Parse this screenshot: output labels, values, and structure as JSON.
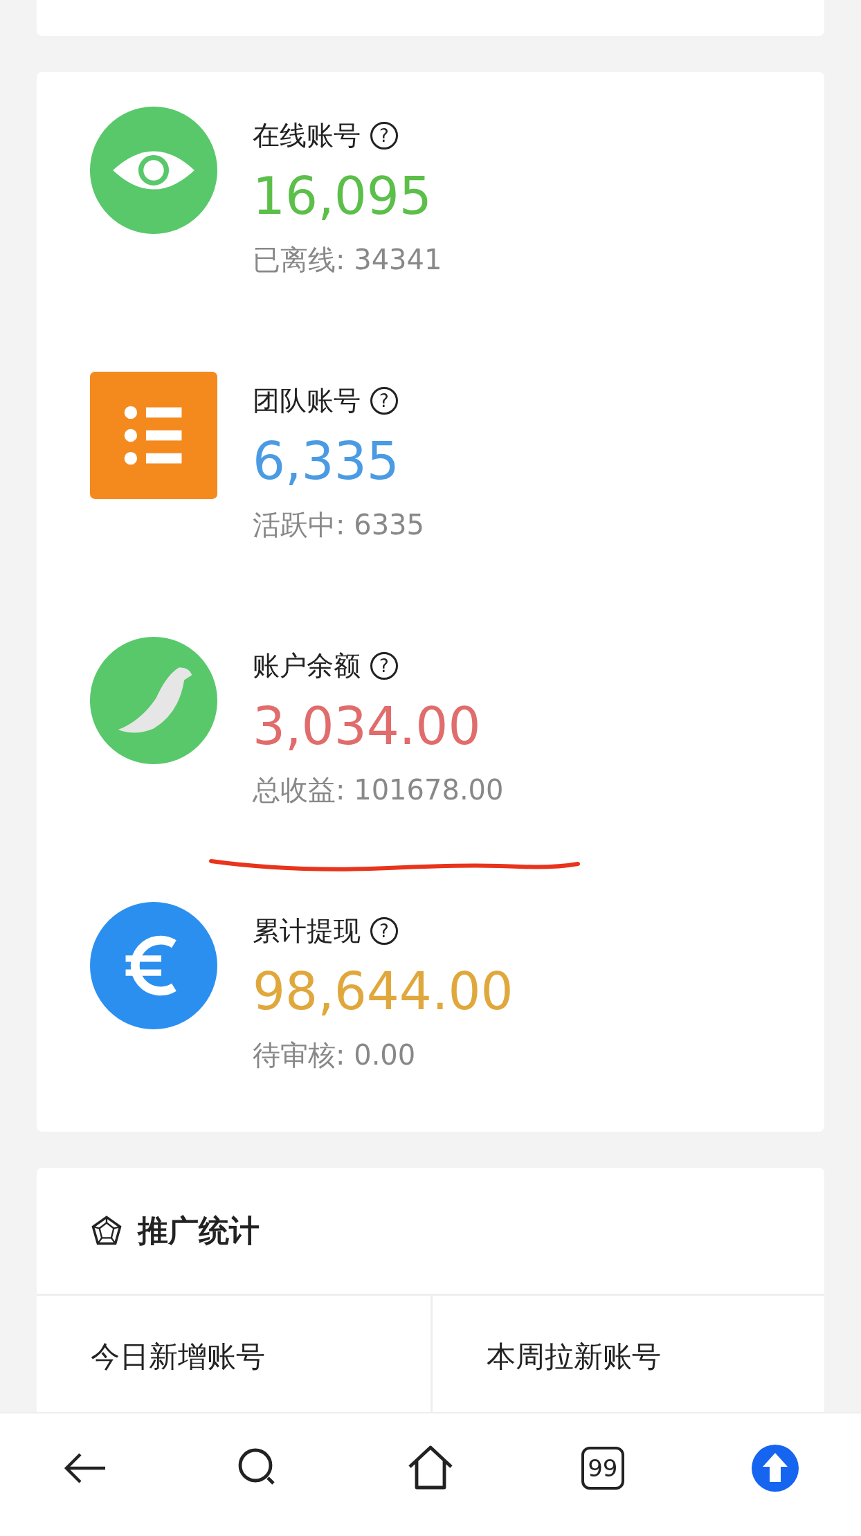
{
  "stats": [
    {
      "kind": "eye",
      "title": "在线账号",
      "help": "?",
      "value": "16,095",
      "color": "#5cbf4a",
      "sub": "已离线: 34341"
    },
    {
      "kind": "list",
      "title": "团队账号",
      "help": "?",
      "value": "6,335",
      "color": "#4a9be3",
      "sub": "活跃中: 6335"
    },
    {
      "kind": "bird",
      "title": "账户余额",
      "help": "?",
      "value": "3,034.00",
      "color": "#e06c6c",
      "sub": "总收益: 101678.00"
    },
    {
      "kind": "euro",
      "title": "累计提现",
      "help": "?",
      "value": "98,644.00",
      "color": "#e0a83c",
      "sub": "待审核: 0.00"
    }
  ],
  "promo": {
    "title": "推广统计",
    "cells": [
      {
        "label": "今日新增账号"
      },
      {
        "label": "本周拉新账号"
      }
    ]
  },
  "nav": [
    {
      "kind": "back"
    },
    {
      "kind": "search"
    },
    {
      "kind": "home"
    },
    {
      "kind": "tabs",
      "label": "99"
    },
    {
      "kind": "upload"
    }
  ]
}
